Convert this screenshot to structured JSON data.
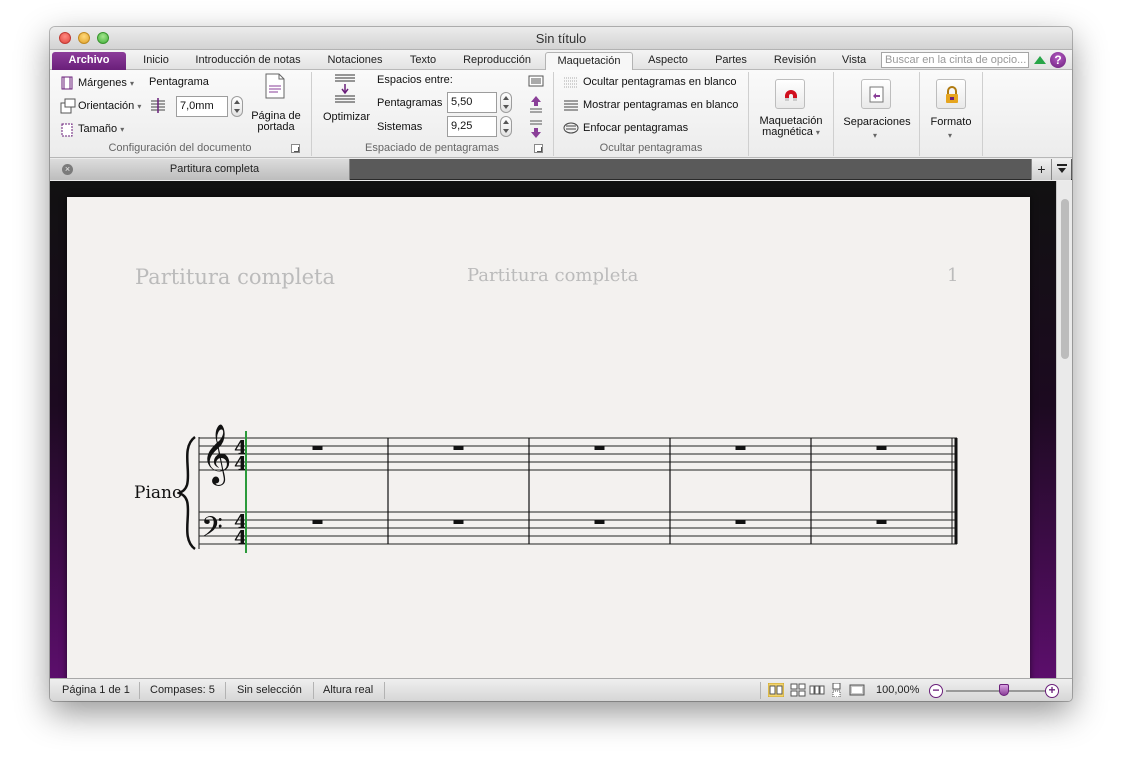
{
  "window": {
    "title": "Sin título"
  },
  "ribbon_tabs": [
    {
      "label": "Archivo"
    },
    {
      "label": "Inicio"
    },
    {
      "label": "Introducción de notas"
    },
    {
      "label": "Notaciones"
    },
    {
      "label": "Texto"
    },
    {
      "label": "Reproducción"
    },
    {
      "label": "Maquetación"
    },
    {
      "label": "Aspecto"
    },
    {
      "label": "Partes"
    },
    {
      "label": "Revisión"
    },
    {
      "label": "Vista"
    }
  ],
  "active_tab": "Maquetación",
  "search": {
    "placeholder": "Buscar en la cinta de opcio..."
  },
  "help": {
    "label": "?"
  },
  "groups": {
    "doc_setup": {
      "label": "Configuración del documento",
      "margins": "Márgenes",
      "orientation": "Orientación",
      "size": "Tamaño",
      "staff_label": "Pentagrama",
      "staff_size": "7,0mm",
      "cover_page_line1": "Página de",
      "cover_page_line2": "portada"
    },
    "staff_spacing": {
      "label": "Espaciado de pentagramas",
      "optimize": "Optimizar",
      "spaces_between": "Espacios entre:",
      "staves_label": "Pentagramas",
      "staves_value": "5,50",
      "systems_label": "Sistemas",
      "systems_value": "9,25"
    },
    "hide_staves": {
      "label": "Ocultar pentagramas",
      "hide_empty": "Ocultar pentagramas en blanco",
      "show_empty": "Mostrar pentagramas en blanco",
      "focus": "Enfocar pentagramas"
    },
    "magnetic": {
      "line1": "Maquetación",
      "line2": "magnética"
    },
    "breaks": {
      "label": "Separaciones"
    },
    "format": {
      "label": "Formato"
    }
  },
  "doc_tab": {
    "label": "Partitura completa",
    "close": "×",
    "add": "+"
  },
  "score": {
    "header_left": "Partitura completa",
    "header_center": "Partitura completa",
    "page_number": "1",
    "instrument": "Piano",
    "time_signature": {
      "numerator": "4",
      "denominator": "4"
    },
    "bars": 5
  },
  "statusbar": {
    "page": "Página 1 de 1",
    "bars": "Compases: 5",
    "selection": "Sin selección",
    "pitch": "Altura real",
    "zoom": "100,00%",
    "zoom_level": 0.58
  },
  "colors": {
    "accent": "#6a1f7a",
    "green": "#27a548"
  }
}
